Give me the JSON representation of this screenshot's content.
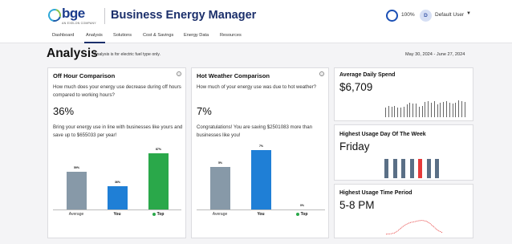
{
  "header": {
    "brand": "bge",
    "brand_sub": "AN EXELON COMPANY",
    "app_title": "Business Energy Manager",
    "progress": "100%",
    "user_initial": "D",
    "user_name": "Default User",
    "caret": "▼"
  },
  "nav": {
    "items": [
      {
        "label": "Dashboard"
      },
      {
        "label": "Analysis",
        "active": true
      },
      {
        "label": "Solutions"
      },
      {
        "label": "Cost & Savings"
      },
      {
        "label": "Energy Data"
      },
      {
        "label": "Resources"
      }
    ]
  },
  "page": {
    "title": "Analysis",
    "subtitle": "Analysis is for electric fuel type only.",
    "date_range": "May 30, 2024 - June 27, 2024"
  },
  "off_hour": {
    "title": "Off Hour Comparison",
    "info": "?",
    "question": "How much does your energy use decrease during off hours compared to working hours?",
    "percent": "36%",
    "message": "Bring your energy use in line with businesses like yours and save up to $655033 per year!",
    "chart_data": {
      "type": "bar",
      "categories": [
        "Average",
        "You",
        "Top"
      ],
      "values": [
        59,
        36,
        87
      ],
      "value_labels": [
        "59%",
        "36%",
        "87%"
      ],
      "colors": [
        "#8799a8",
        "#1f7fd6",
        "#2aa84a"
      ],
      "ylim": [
        0,
        100
      ]
    }
  },
  "hot_weather": {
    "title": "Hot Weather Comparison",
    "info": "?",
    "question": "How much of your energy use was due to hot weather?",
    "percent": "7%",
    "message": "Congratulations! You are saving $2501083 more than businesses like you!",
    "chart_data": {
      "type": "bar",
      "categories": [
        "Average",
        "You",
        "Top"
      ],
      "values": [
        5,
        7,
        0
      ],
      "value_labels": [
        "5%",
        "7%",
        "0%"
      ],
      "colors": [
        "#8799a8",
        "#1f7fd6",
        "#2aa84a"
      ],
      "ylim": [
        0,
        7.6
      ]
    }
  },
  "daily_spend": {
    "title": "Average Daily Spend",
    "value": "$6,709",
    "chart_data": {
      "type": "bar",
      "values": [
        6,
        7,
        6.5,
        6.8,
        6.2,
        5.8,
        6.5,
        8,
        9,
        8.5,
        8.3,
        6.5,
        7,
        9.6,
        10,
        9,
        9.8,
        8.2,
        9,
        9.5,
        10,
        9,
        8.5,
        9.2,
        10.5,
        10,
        9.6
      ],
      "color": "#666666",
      "ylim": [
        0,
        11
      ]
    }
  },
  "usage_day": {
    "title": "Highest Usage Day Of The Week",
    "value": "Friday",
    "chart_data": {
      "type": "bar",
      "values": [
        10,
        10,
        10,
        10,
        10,
        10,
        10
      ],
      "highlight_index": 4,
      "color": "#5a6f86",
      "highlight_color": "#e63a3a",
      "ylim": [
        0,
        10
      ]
    }
  },
  "usage_time": {
    "title": "Highest Usage Time Period",
    "value": "5-8 PM",
    "chart_data": {
      "type": "line",
      "values": [
        1,
        1.2,
        1.6,
        3,
        5,
        6.5,
        7.6,
        8,
        8.6,
        8.8,
        8.4,
        7,
        5,
        3,
        2
      ],
      "color": "#e63a3a",
      "ylim": [
        0,
        10
      ]
    }
  }
}
